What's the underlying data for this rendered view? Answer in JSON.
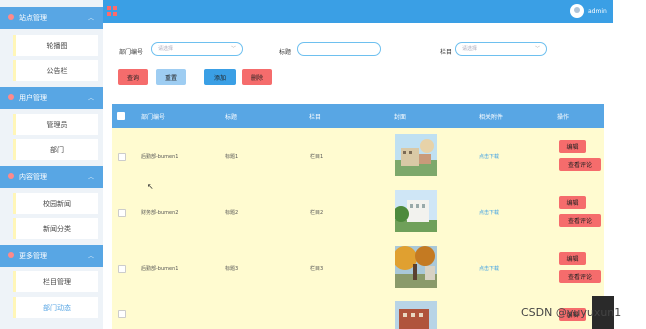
{
  "sidebar": {
    "groups": [
      {
        "label": "站点管理",
        "items": [
          "轮播图",
          "公告栏"
        ]
      },
      {
        "label": "用户管理",
        "items": [
          "管理员",
          "部门"
        ]
      },
      {
        "label": "内容管理",
        "items": [
          "校园新闻",
          "新闻分类"
        ]
      },
      {
        "label": "更多管理",
        "items": [
          "栏目管理",
          "部门动态"
        ]
      }
    ],
    "active_item": "部门动态"
  },
  "header": {
    "user": "admin"
  },
  "filters": {
    "dept_label": "部门编号",
    "dept_placeholder": "请选择",
    "title_label": "标题",
    "title_value": "",
    "column_label": "栏目",
    "column_placeholder": "请选择"
  },
  "actions": {
    "query": "查询",
    "reset": "重置",
    "add": "添加",
    "delete": "删除"
  },
  "table": {
    "headers": [
      "部门编号",
      "标题",
      "栏目",
      "封面",
      "相关附件",
      "操作"
    ],
    "rows": [
      {
        "dept": "后勤部-bumen1",
        "title": "标题1",
        "column": "栏目1",
        "attachment": "点击下载",
        "edit": "编辑",
        "comments": "查看评论"
      },
      {
        "dept": "财务部-bumen2",
        "title": "标题2",
        "column": "栏目2",
        "attachment": "点击下载",
        "edit": "编辑",
        "comments": "查看评论"
      },
      {
        "dept": "后勤部-bumen1",
        "title": "标题3",
        "column": "栏目3",
        "attachment": "点击下载",
        "edit": "编辑",
        "comments": "查看评论"
      },
      {
        "dept": "",
        "title": "",
        "column": "",
        "attachment": "",
        "edit": "编辑",
        "comments": ""
      }
    ]
  },
  "watermark": "CSDN @yuyuxun1",
  "colors": {
    "primary": "#3a9fe5",
    "danger": "#f56c6c",
    "row_bg": "#fffbd0",
    "sidebar_group": "#58a6e4"
  }
}
